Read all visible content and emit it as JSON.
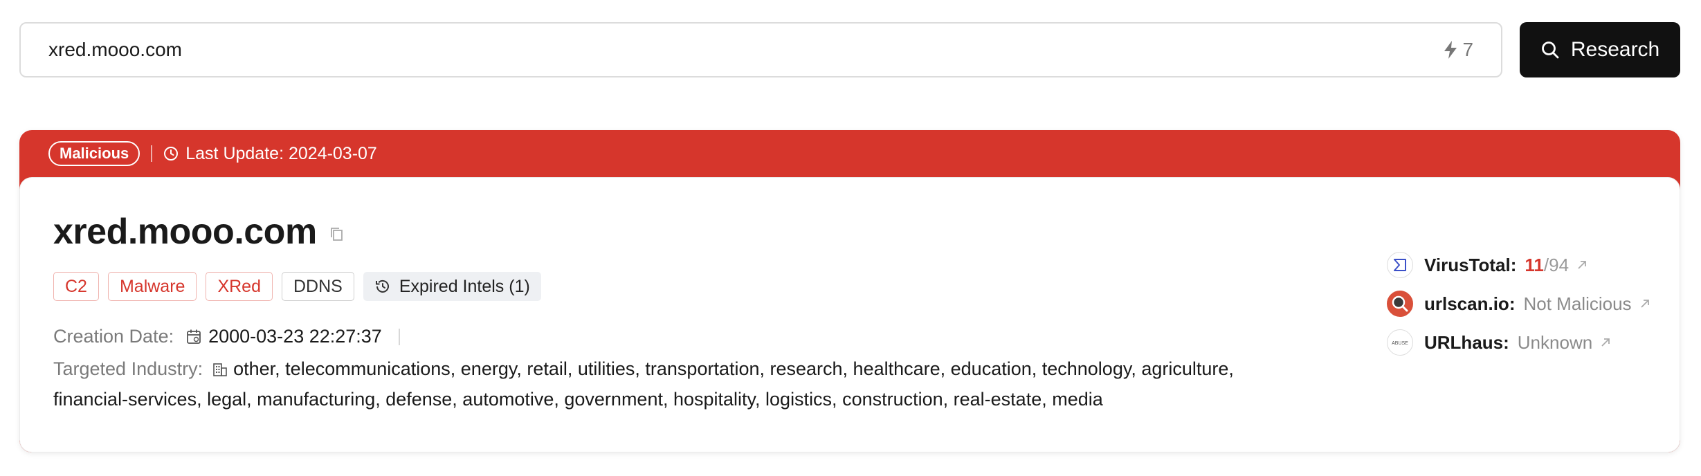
{
  "search": {
    "value": "xred.mooo.com",
    "quota": "7",
    "button_label": "Research",
    "icons": {
      "quota": "lightning-icon",
      "button": "search-icon"
    }
  },
  "banner": {
    "status": "Malicious",
    "last_update": "Last Update: 2024-03-07",
    "color": "#d6362c",
    "icon": "clock-icon"
  },
  "entity": {
    "title": "xred.mooo.com",
    "tags": [
      {
        "label": "C2",
        "style": "red"
      },
      {
        "label": "Malware",
        "style": "red"
      },
      {
        "label": "XRed",
        "style": "red"
      },
      {
        "label": "DDNS",
        "style": "gray"
      }
    ],
    "expired_intels": "Expired Intels (1)",
    "creation_date_label": "Creation Date:",
    "creation_date": "2000-03-23 22:27:37",
    "industry_label": "Targeted Industry:",
    "industries": "other, telecommunications, energy, retail, utilities, transportation, research, healthcare, education, technology, agriculture, financial-services, legal, manufacturing, defense, automotive, government, hospitality, logistics, construction, real-estate, media"
  },
  "sources": {
    "virustotal": {
      "name": "VirusTotal:",
      "hits": "11",
      "total": "/94"
    },
    "urlscan": {
      "name": "urlscan.io:",
      "value": "Not Malicious"
    },
    "urlhaus": {
      "name": "URLhaus:",
      "value": "Unknown",
      "logo_text": "ABUSE"
    }
  }
}
